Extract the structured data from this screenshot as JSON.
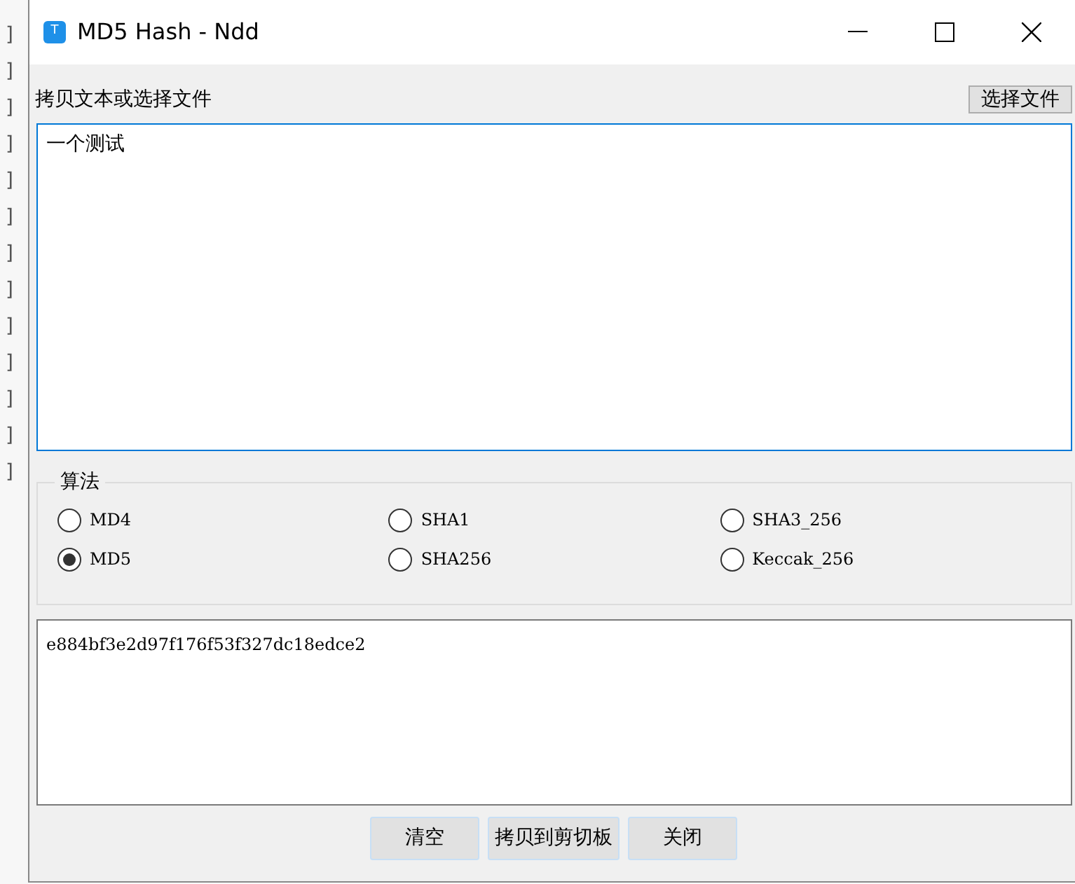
{
  "background_marks": [
    "]",
    "]",
    "]",
    "]",
    "]",
    "]",
    "]",
    "]",
    "]",
    "]",
    "]",
    "]",
    "]"
  ],
  "window": {
    "title": "MD5 Hash - Ndd",
    "app_icon_letter": "T"
  },
  "input_label": "拷贝文本或选择文件",
  "choose_file_button": "选择文件",
  "input_text": "一个测试",
  "algorithm_group": {
    "title": "算法",
    "options": [
      {
        "label": "MD4",
        "selected": false
      },
      {
        "label": "SHA1",
        "selected": false
      },
      {
        "label": "SHA3_256",
        "selected": false
      },
      {
        "label": "MD5",
        "selected": true
      },
      {
        "label": "SHA256",
        "selected": false
      },
      {
        "label": "Keccak_256",
        "selected": false
      }
    ]
  },
  "output_text": "e884bf3e2d97f176f53f327dc18edce2",
  "buttons": [
    "清空",
    "拷贝到剪切板",
    "关闭"
  ]
}
